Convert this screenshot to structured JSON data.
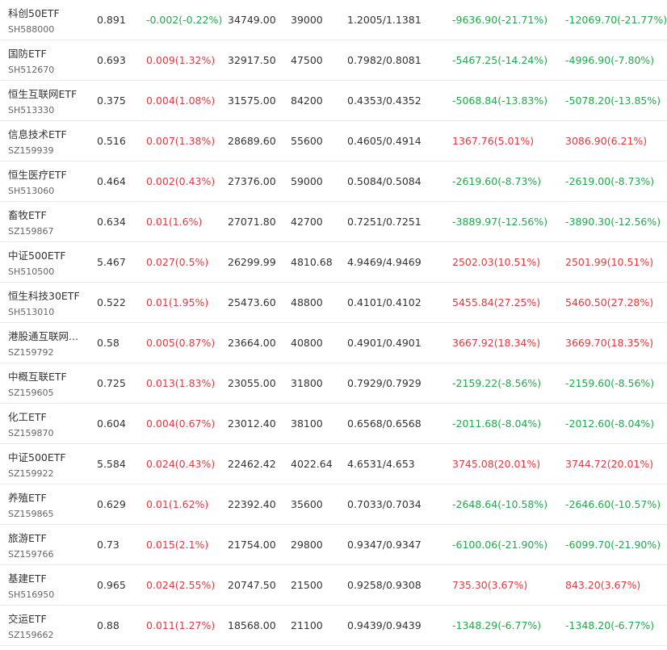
{
  "colors": {
    "up": "#e4393c",
    "down": "#22a84a",
    "text": "#333333",
    "code": "#666666",
    "border": "#e8e8e8"
  },
  "rows": [
    {
      "name": "科创50ETF",
      "code": "SH588000",
      "price": "0.891",
      "change": "-0.002(-0.22%)",
      "change_dir": "down",
      "amount": "34749.00",
      "volume": "39000",
      "range": "1.2005/1.1381",
      "pnl1": "-9636.90(-21.71%)",
      "pnl1_dir": "down",
      "pnl2": "-12069.70(-21.77%)",
      "pnl2_dir": "down"
    },
    {
      "name": "国防ETF",
      "code": "SH512670",
      "price": "0.693",
      "change": "0.009(1.32%)",
      "change_dir": "up",
      "amount": "32917.50",
      "volume": "47500",
      "range": "0.7982/0.8081",
      "pnl1": "-5467.25(-14.24%)",
      "pnl1_dir": "down",
      "pnl2": "-4996.90(-7.80%)",
      "pnl2_dir": "down"
    },
    {
      "name": "恒生互联网ETF",
      "code": "SH513330",
      "price": "0.375",
      "change": "0.004(1.08%)",
      "change_dir": "up",
      "amount": "31575.00",
      "volume": "84200",
      "range": "0.4353/0.4352",
      "pnl1": "-5068.84(-13.83%)",
      "pnl1_dir": "down",
      "pnl2": "-5078.20(-13.85%)",
      "pnl2_dir": "down"
    },
    {
      "name": "信息技术ETF",
      "code": "SZ159939",
      "price": "0.516",
      "change": "0.007(1.38%)",
      "change_dir": "up",
      "amount": "28689.60",
      "volume": "55600",
      "range": "0.4605/0.4914",
      "pnl1": "1367.76(5.01%)",
      "pnl1_dir": "up",
      "pnl2": "3086.90(6.21%)",
      "pnl2_dir": "up"
    },
    {
      "name": "恒生医疗ETF",
      "code": "SH513060",
      "price": "0.464",
      "change": "0.002(0.43%)",
      "change_dir": "up",
      "amount": "27376.00",
      "volume": "59000",
      "range": "0.5084/0.5084",
      "pnl1": "-2619.60(-8.73%)",
      "pnl1_dir": "down",
      "pnl2": "-2619.00(-8.73%)",
      "pnl2_dir": "down"
    },
    {
      "name": "畜牧ETF",
      "code": "SZ159867",
      "price": "0.634",
      "change": "0.01(1.6%)",
      "change_dir": "up",
      "amount": "27071.80",
      "volume": "42700",
      "range": "0.7251/0.7251",
      "pnl1": "-3889.97(-12.56%)",
      "pnl1_dir": "down",
      "pnl2": "-3890.30(-12.56%)",
      "pnl2_dir": "down"
    },
    {
      "name": "中证500ETF",
      "code": "SH510500",
      "price": "5.467",
      "change": "0.027(0.5%)",
      "change_dir": "up",
      "amount": "26299.99",
      "volume": "4810.68",
      "range": "4.9469/4.9469",
      "pnl1": "2502.03(10.51%)",
      "pnl1_dir": "up",
      "pnl2": "2501.99(10.51%)",
      "pnl2_dir": "up"
    },
    {
      "name": "恒生科技30ETF",
      "code": "SH513010",
      "price": "0.522",
      "change": "0.01(1.95%)",
      "change_dir": "up",
      "amount": "25473.60",
      "volume": "48800",
      "range": "0.4101/0.4102",
      "pnl1": "5455.84(27.25%)",
      "pnl1_dir": "up",
      "pnl2": "5460.50(27.28%)",
      "pnl2_dir": "up"
    },
    {
      "name": "港股通互联网...",
      "code": "SZ159792",
      "price": "0.58",
      "change": "0.005(0.87%)",
      "change_dir": "up",
      "amount": "23664.00",
      "volume": "40800",
      "range": "0.4901/0.4901",
      "pnl1": "3667.92(18.34%)",
      "pnl1_dir": "up",
      "pnl2": "3669.70(18.35%)",
      "pnl2_dir": "up"
    },
    {
      "name": "中概互联ETF",
      "code": "SZ159605",
      "price": "0.725",
      "change": "0.013(1.83%)",
      "change_dir": "up",
      "amount": "23055.00",
      "volume": "31800",
      "range": "0.7929/0.7929",
      "pnl1": "-2159.22(-8.56%)",
      "pnl1_dir": "down",
      "pnl2": "-2159.60(-8.56%)",
      "pnl2_dir": "down"
    },
    {
      "name": "化工ETF",
      "code": "SZ159870",
      "price": "0.604",
      "change": "0.004(0.67%)",
      "change_dir": "up",
      "amount": "23012.40",
      "volume": "38100",
      "range": "0.6568/0.6568",
      "pnl1": "-2011.68(-8.04%)",
      "pnl1_dir": "down",
      "pnl2": "-2012.60(-8.04%)",
      "pnl2_dir": "down"
    },
    {
      "name": "中证500ETF",
      "code": "SZ159922",
      "price": "5.584",
      "change": "0.024(0.43%)",
      "change_dir": "up",
      "amount": "22462.42",
      "volume": "4022.64",
      "range": "4.6531/4.653",
      "pnl1": "3745.08(20.01%)",
      "pnl1_dir": "up",
      "pnl2": "3744.72(20.01%)",
      "pnl2_dir": "up"
    },
    {
      "name": "养殖ETF",
      "code": "SZ159865",
      "price": "0.629",
      "change": "0.01(1.62%)",
      "change_dir": "up",
      "amount": "22392.40",
      "volume": "35600",
      "range": "0.7033/0.7034",
      "pnl1": "-2648.64(-10.58%)",
      "pnl1_dir": "down",
      "pnl2": "-2646.60(-10.57%)",
      "pnl2_dir": "down"
    },
    {
      "name": "旅游ETF",
      "code": "SZ159766",
      "price": "0.73",
      "change": "0.015(2.1%)",
      "change_dir": "up",
      "amount": "21754.00",
      "volume": "29800",
      "range": "0.9347/0.9347",
      "pnl1": "-6100.06(-21.90%)",
      "pnl1_dir": "down",
      "pnl2": "-6099.70(-21.90%)",
      "pnl2_dir": "down"
    },
    {
      "name": "基建ETF",
      "code": "SH516950",
      "price": "0.965",
      "change": "0.024(2.55%)",
      "change_dir": "up",
      "amount": "20747.50",
      "volume": "21500",
      "range": "0.9258/0.9308",
      "pnl1": "735.30(3.67%)",
      "pnl1_dir": "up",
      "pnl2": "843.20(3.67%)",
      "pnl2_dir": "up"
    },
    {
      "name": "交运ETF",
      "code": "SZ159662",
      "price": "0.88",
      "change": "0.011(1.27%)",
      "change_dir": "up",
      "amount": "18568.00",
      "volume": "21100",
      "range": "0.9439/0.9439",
      "pnl1": "-1348.29(-6.77%)",
      "pnl1_dir": "down",
      "pnl2": "-1348.20(-6.77%)",
      "pnl2_dir": "down"
    }
  ]
}
